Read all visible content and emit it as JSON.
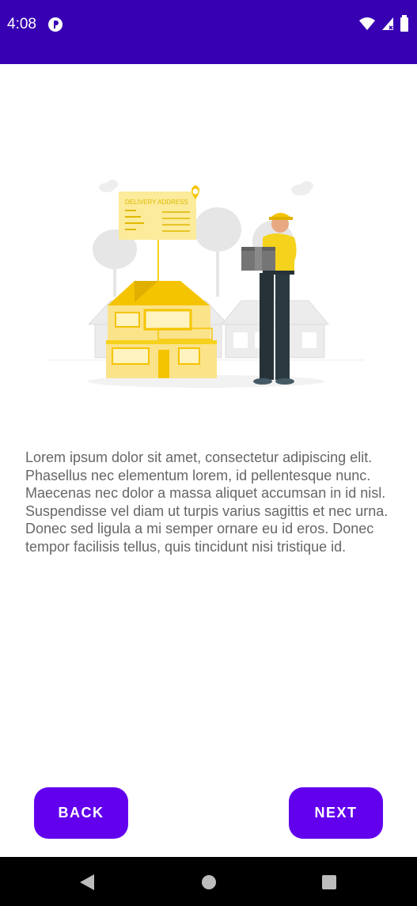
{
  "status_bar": {
    "time": "4:08",
    "background_color": "#3700b3",
    "icons": [
      "notification-app-icon",
      "wifi-icon",
      "cellular-signal-icon",
      "battery-icon"
    ]
  },
  "illustration": {
    "card_title": "DELIVERY ADDRESS",
    "accent_color": "#f5d21c",
    "icons": [
      "location-pin-icon",
      "house",
      "delivery-person",
      "package-box",
      "trees",
      "clouds"
    ]
  },
  "body": {
    "description": "Lorem ipsum dolor sit amet, consectetur adipiscing elit. Phasellus nec elementum lorem, id pellentesque nunc. Maecenas nec dolor a massa aliquet accumsan in id nisl. Suspendisse vel diam ut turpis varius sagittis et nec urna. Donec sed ligula a mi semper ornare eu id eros. Donec tempor facilisis tellus, quis tincidunt nisi tristique id."
  },
  "buttons": {
    "back_label": "BACK",
    "next_label": "NEXT",
    "color": "#6200ee"
  },
  "nav_bar": {
    "icons": [
      "back-triangle-icon",
      "home-circle-icon",
      "recents-square-icon"
    ]
  }
}
